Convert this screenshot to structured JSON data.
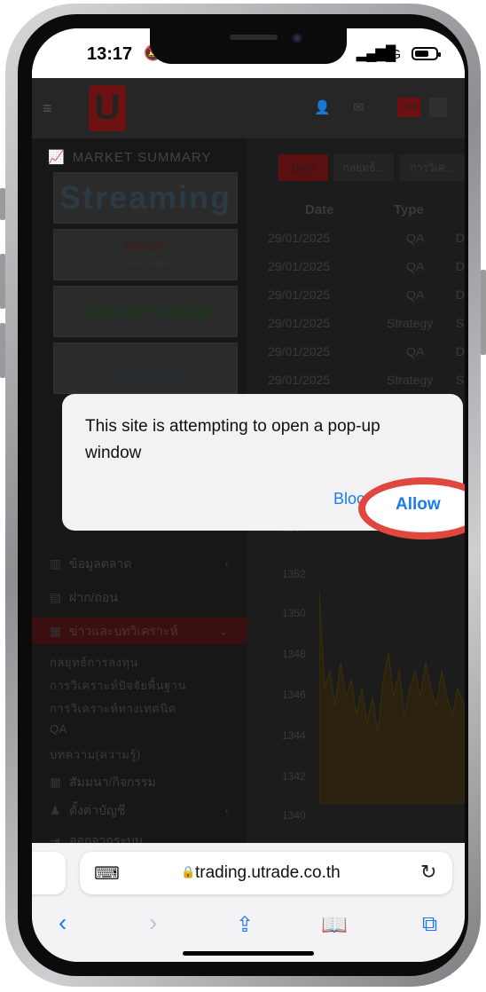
{
  "status_bar": {
    "time": "13:17",
    "network": "5G"
  },
  "site": {
    "logo_text": "U",
    "lang_badge": "TH",
    "sidebar": {
      "market_summary": "MARKET SUMMARY",
      "promos": {
        "streaming": "Streaming",
        "utrade": "Utrade",
        "utrade_sub": "Global Trade",
        "efin": "StockPickUp",
        "trademan": "TRADEMAN"
      },
      "menu": [
        {
          "label": "ข้อมูลตลาด",
          "icon": "chart-icon",
          "arrow": "‹"
        },
        {
          "label": "ฝาก/ถอน",
          "icon": "document-icon",
          "arrow": ""
        },
        {
          "label": "ข่าวและบทวิเคราะห์",
          "icon": "news-icon",
          "arrow": "⌄"
        }
      ],
      "submenu": [
        "กลยุทธ์การลงทุน",
        "การวิเคราะห์ปัจจัยพื้นฐาน",
        "การวิเคราะห์ทางเทคนิค",
        "QA",
        "บทความ(ความรู้)"
      ],
      "menu_bottom": [
        {
          "label": "สัมมนา/กิจกรรม",
          "icon": "calendar-icon",
          "arrow": ""
        },
        {
          "label": "ตั้งค่าบัญชี",
          "icon": "user-icon",
          "arrow": "‹"
        },
        {
          "label": "ออกจากระบบ",
          "icon": "logout-icon",
          "arrow": ""
        }
      ]
    },
    "content": {
      "tabs": [
        "Daily",
        "กลยุทธ์...",
        "การวิเค..."
      ],
      "columns": [
        "Date",
        "Type"
      ],
      "rows": [
        {
          "date": "29/01/2025",
          "type": "QA",
          "extra": "D"
        },
        {
          "date": "29/01/2025",
          "type": "QA",
          "extra": "D"
        },
        {
          "date": "29/01/2025",
          "type": "QA",
          "extra": "D"
        },
        {
          "date": "29/01/2025",
          "type": "Strategy",
          "extra": "S"
        },
        {
          "date": "29/01/2025",
          "type": "QA",
          "extra": "D"
        },
        {
          "date": "29/01/2025",
          "type": "Strategy",
          "extra": "S"
        }
      ],
      "chart_axis": [
        "1354",
        "1352",
        "1350",
        "1348",
        "1346",
        "1344",
        "1342",
        "1340"
      ]
    }
  },
  "popup": {
    "message": "This site is attempting to open a pop-up window",
    "block_label": "Bloc",
    "allow_label": "Allow"
  },
  "browser": {
    "url_host": "trading.utrade.co.th",
    "lock_icon": "lock-icon",
    "reader_icon": "reader-icon",
    "reload_icon": "reload-icon"
  }
}
